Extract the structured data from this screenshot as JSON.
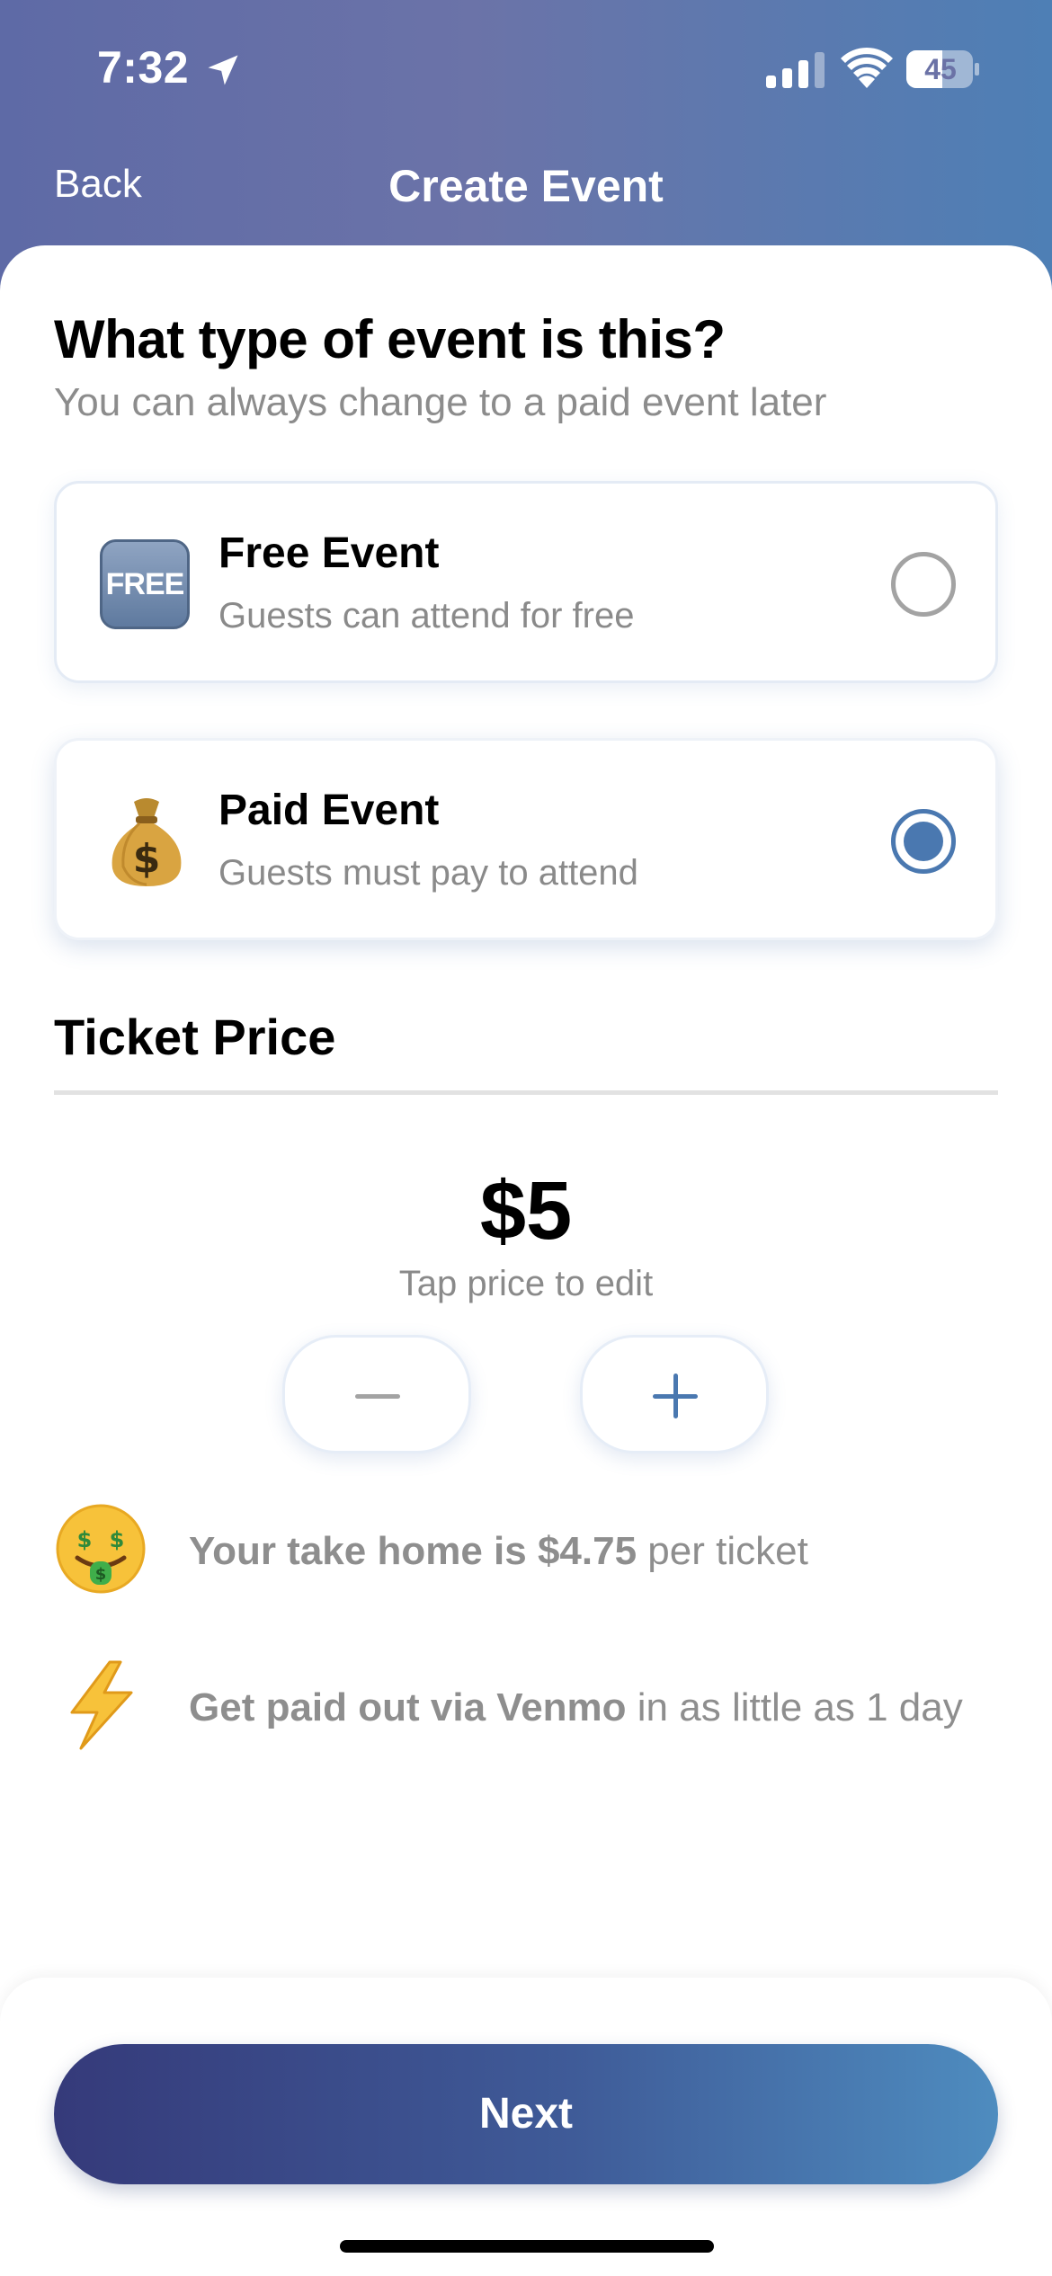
{
  "status_bar": {
    "time": "7:32",
    "battery": "45",
    "icons": [
      "location-arrow-icon",
      "cellular-signal-icon",
      "wifi-icon",
      "battery-icon"
    ]
  },
  "nav": {
    "back_label": "Back",
    "title": "Create Event"
  },
  "event_type": {
    "question": "What type of event is this?",
    "subtitle": "You can always change to a paid event later",
    "options": [
      {
        "icon": "free-badge-icon",
        "badge_text": "FREE",
        "title": "Free Event",
        "description": "Guests can attend for free",
        "selected": false
      },
      {
        "icon": "money-bag-icon",
        "title": "Paid Event",
        "description": "Guests must pay to attend",
        "selected": true
      }
    ]
  },
  "ticket_price": {
    "section_title": "Ticket Price",
    "price": "$5",
    "hint": "Tap price to edit",
    "decrement_icon": "minus-icon",
    "increment_icon": "plus-icon"
  },
  "info": [
    {
      "icon": "money-mouth-face-icon",
      "bold": "Your take home is $4.75",
      "rest": " per ticket"
    },
    {
      "icon": "lightning-bolt-icon",
      "bold": "Get paid out via Venmo",
      "rest": " in as little as 1 day"
    }
  ],
  "footer": {
    "next_label": "Next"
  },
  "colors": {
    "accent": "#4a78b0",
    "header_gradient_start": "#5e6aa6",
    "header_gradient_end": "#4e7fb5",
    "button_gradient_start": "#353a7a",
    "button_gradient_end": "#4e8cbf",
    "muted_text": "#8c8c8c"
  }
}
